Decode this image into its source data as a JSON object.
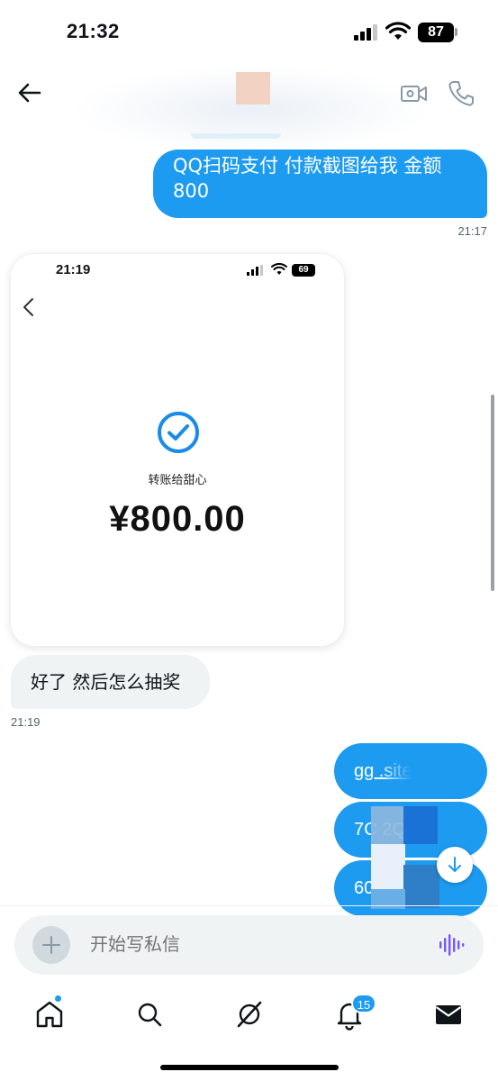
{
  "status_bar": {
    "time": "21:32",
    "battery": "87"
  },
  "messages": {
    "outgoing_1": {
      "text": "QQ扫码支付 付款截图给我 金额800",
      "time": "21:17"
    },
    "screenshot": {
      "time": "21:19",
      "battery": "69",
      "label": "转账给甜心",
      "amount": "¥800.00"
    },
    "incoming_1": {
      "text": "好了 然后怎么抽奖",
      "time": "21:19"
    },
    "link_bubbles": [
      "gg        .site",
      "7C            2Q",
      "60            S4"
    ]
  },
  "composer": {
    "placeholder": "开始写私信"
  },
  "nav": {
    "notifications_badge": "15"
  },
  "colors": {
    "accent": "#1d9bf0",
    "incoming_bubble": "#eff3f4"
  }
}
